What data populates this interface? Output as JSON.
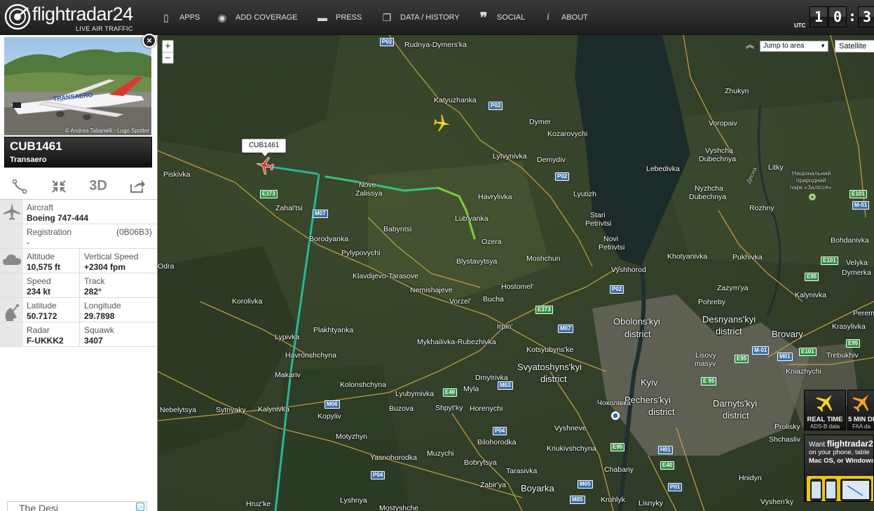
{
  "app": {
    "logo_text": "flightradar24",
    "logo_tagline": "LIVE AIR TRAFFIC",
    "nav": [
      {
        "label": "APPS",
        "icon": "phone-icon"
      },
      {
        "label": "ADD COVERAGE",
        "icon": "eye-icon"
      },
      {
        "label": "PRESS",
        "icon": "chat-bubble-icon"
      },
      {
        "label": "DATA / HISTORY",
        "icon": "box-icon"
      },
      {
        "label": "SOCIAL",
        "icon": "quote-icon"
      },
      {
        "label": "ABOUT",
        "icon": "info-icon"
      }
    ],
    "clock": {
      "label": "UTC",
      "hours": "10",
      "minutes": "3"
    }
  },
  "flight": {
    "photo_credit": "© Andrea Tabanelli - Lugo Spotter",
    "callsign": "CUB1461",
    "airline": "Transaero",
    "tools": [
      {
        "name": "route-tool",
        "icon": "route-icon"
      },
      {
        "name": "center-tool",
        "icon": "collapse-arrows-icon"
      },
      {
        "name": "3d-tool",
        "label": "3D"
      },
      {
        "name": "share-tool",
        "icon": "share-icon"
      }
    ],
    "aircraft_label": "Aircraft",
    "aircraft": "Boeing 747-444",
    "registration_label": "Registration",
    "registration": "-",
    "mode_s": "(0B06B3)",
    "altitude_label": "Altitude",
    "altitude": "10,575 ft",
    "vspeed_label": "Vertical Speed",
    "vspeed": "+2304 fpm",
    "speed_label": "Speed",
    "speed": "234 kt",
    "track_label": "Track",
    "track": "282°",
    "latitude_label": "Latitude",
    "latitude": "50.7172",
    "longitude_label": "Longitude",
    "longitude": "29.7898",
    "radar_label": "Radar",
    "radar": "F-UKKK2",
    "squawk_label": "Squawk",
    "squawk": "3407",
    "ad_text": "The Desi"
  },
  "map": {
    "zoom_in": "+",
    "zoom_out": "−",
    "jump_label": "Jump to area",
    "maptype_label": "Satellite",
    "callout": "CUB1461",
    "places": [
      "Rudnya-Dymers'ka",
      "Katyuzhanka",
      "Dymer",
      "Kozarovychi",
      "Lytvynivka",
      "Demydiv",
      "Piskivka",
      "Zahal'tsi",
      "Nove",
      "Zalissya",
      "Havrylivka",
      "Lyutizh",
      "Lub'yanka",
      "Babyntsi",
      "Borodyanka",
      "Pylypovychi",
      "Ozera",
      "Stari",
      "Petrivtsi",
      "Novi",
      "Petrivtsi",
      "Blystavytsya",
      "Moshchun",
      "Vyshhorod",
      "Klavdijevo-Tarasove",
      "Nemishajeve",
      "Hostomel'",
      "Vorzel'",
      "Bucha",
      "Korolivka",
      "Irpin'",
      "Plakhtyanka",
      "Lypivka",
      "Mykhailivka-Rubezhivka",
      "Kotsyubyns'ke",
      "Havronshchyna",
      "Makariv",
      "Dmytrivka",
      "Kolonshchyna",
      "Lyubymivka",
      "Myla",
      "Nebelytsya",
      "Sytnyaky",
      "Kalynivka",
      "Buzova",
      "Shpyt'ky",
      "Horenychi",
      "Kopyliv",
      "Motyzhyn",
      "Bilohorodka",
      "Vyshneve",
      "Yasnohorodka",
      "Muzychi",
      "Kriukivshchyna",
      "Bobrytsya",
      "Tarasivka",
      "Chabany",
      "Boyarka",
      "Zabir'ya",
      "Lyshnya",
      "Mostyshche",
      "Hruz'ke",
      "Kruhlyk",
      "Lisnyky",
      "Odra",
      "Zhukyn",
      "Voropaiv",
      "Lebedivka",
      "Vyshcha",
      "Dubechnya",
      "Nyzhcha",
      "Dubechnya",
      "Litky",
      "Rozhny",
      "Bohdanivka",
      "Khotyanivka",
      "Pukhivka",
      "Velyka",
      "Dymerka",
      "Zazym'ya",
      "Pohreby",
      "Kalynivka",
      "Peremoha",
      "Krasylivka",
      "Brovary",
      "Trebukhiv",
      "Lisovy",
      "masyv",
      "Kniazhychi",
      "Prolisky",
      "Shchasliv",
      "Hnidyn",
      "Vyshen'ky",
      "Obolons'kyi",
      "district",
      "Desnyans'kyi",
      "district",
      "Svyatoshyns'kyi",
      "district",
      "Kyiv",
      "Pechers'kyi",
      "district",
      "Darnyts'kyi",
      "district",
      "Чоколівка",
      "Національний",
      "природний",
      "парк «Залісся»",
      "Десна"
    ],
    "roads": [
      "P02",
      "P02",
      "P02",
      "P02",
      "E373",
      "M07",
      "E373",
      "M07",
      "E40",
      "M03",
      "M06",
      "P04",
      "P04",
      "E95",
      "H01",
      "E40",
      "M05",
      "M05",
      "P01",
      "E101",
      "E95",
      "M-01",
      "M01",
      "E95",
      "E101",
      "E 95",
      "M-01",
      "E95",
      "E101"
    ],
    "promo": [
      {
        "title": "REAL TIME",
        "sub": "ADS-B data"
      },
      {
        "title": "5 MIN DE",
        "sub": "FAA da"
      }
    ],
    "app_promo": {
      "want": "Want",
      "brand": "flightradar24",
      "line1": "on your phone, table",
      "line2": "Mac OS, or Windows"
    },
    "colors": {
      "track_start": "#2bb596",
      "track_end": "#8bd42a",
      "selected_plane": "#e0312e",
      "other_plane": "#f6d626"
    }
  }
}
